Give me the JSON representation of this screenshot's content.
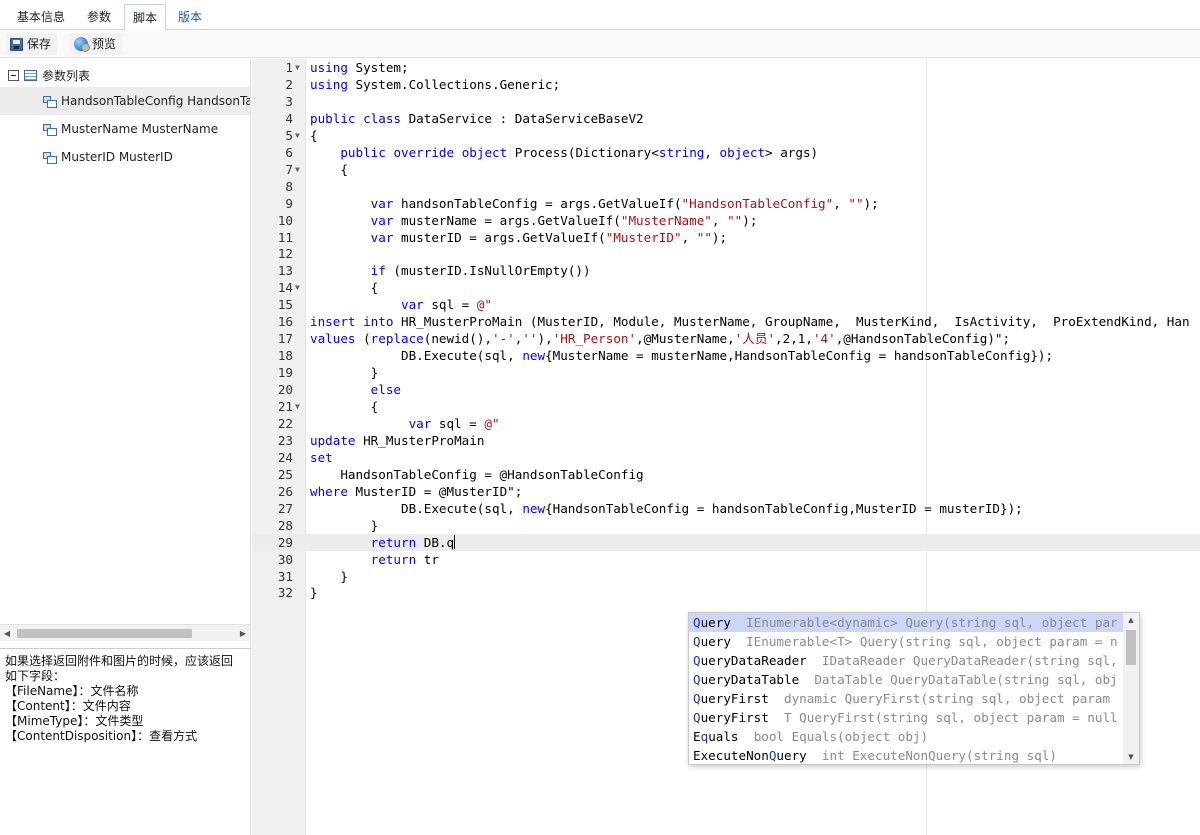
{
  "tabs": [
    {
      "label": "基本信息"
    },
    {
      "label": "参数"
    },
    {
      "label": "脚本"
    },
    {
      "label": "版本"
    }
  ],
  "active_tab": "脚本",
  "toolbar": {
    "save_label": "保存",
    "preview_label": "预览"
  },
  "tree": {
    "root_label": "参数列表",
    "items": [
      {
        "label": "HandsonTableConfig HandsonTableConfig"
      },
      {
        "label": "MusterName MusterName"
      },
      {
        "label": "MusterID MusterID"
      }
    ]
  },
  "help": {
    "lines": [
      "如果选择返回附件和图片的时候，应该返回",
      "如下字段：",
      "【FileName】：文件名称",
      "【Content】：文件内容",
      "【MimeType】：文件类型",
      "【ContentDisposition】：查看方式"
    ]
  },
  "editor": {
    "current_line": 29,
    "lines": [
      "using System;",
      "using System.Collections.Generic;",
      "",
      "public class DataService : DataServiceBaseV2",
      "{",
      "    public override object Process(Dictionary<string, object> args)",
      "    {",
      "",
      "        var handsonTableConfig = args.GetValueIf(\"HandsonTableConfig\", \"\");",
      "        var musterName = args.GetValueIf(\"MusterName\", \"\");",
      "        var musterID = args.GetValueIf(\"MusterID\", \"\");",
      "",
      "        if (musterID.IsNullOrEmpty())",
      "        {",
      "            var sql = @\"",
      "insert into HR_MusterProMain (MusterID, Module, MusterName, GroupName,  MusterKind,  IsActivity,  ProExtendKind, Han",
      "values (replace(newid(),'-',''),'HR_Person',@MusterName,'人员',2,1,'4',@HandsonTableConfig)\";",
      "            DB.Execute(sql, new{MusterName = musterName,HandsonTableConfig = handsonTableConfig});",
      "        }",
      "        else",
      "        {",
      "             var sql = @\"",
      "update HR_MusterProMain",
      "set",
      "    HandsonTableConfig = @HandsonTableConfig",
      "where MusterID = @MusterID\";",
      "            DB.Execute(sql, new{HandsonTableConfig = handsonTableConfig,MusterID = musterID});",
      "        }",
      "        return DB.q",
      "        return tr",
      "    }",
      "}"
    ],
    "fold_lines": [
      1,
      5,
      7,
      14,
      21
    ]
  },
  "autocomplete": {
    "items": [
      {
        "name": "Query",
        "signature": "IEnumerable<dynamic> Query(string sql, object par"
      },
      {
        "name": "Query",
        "signature": "IEnumerable<T> Query(string sql, object param = n"
      },
      {
        "name": "QueryDataReader",
        "signature": "IDataReader QueryDataReader(string sql,"
      },
      {
        "name": "QueryDataTable",
        "signature": "DataTable QueryDataTable(string sql, obj"
      },
      {
        "name": "QueryFirst",
        "signature": "dynamic QueryFirst(string sql, object param"
      },
      {
        "name": "QueryFirst",
        "signature": "T QueryFirst(string sql, object param = null"
      },
      {
        "name": "Equals",
        "signature": "bool Equals(object obj)"
      },
      {
        "name": "ExecuteNonQuery",
        "signature": "int ExecuteNonQuery(string sql)"
      }
    ],
    "selected_index": 0
  },
  "colors": {
    "keyword": "#0000ff",
    "string": "#a31515",
    "tab_link": "#1a5da8",
    "ac_selected": "#cad6fa"
  }
}
